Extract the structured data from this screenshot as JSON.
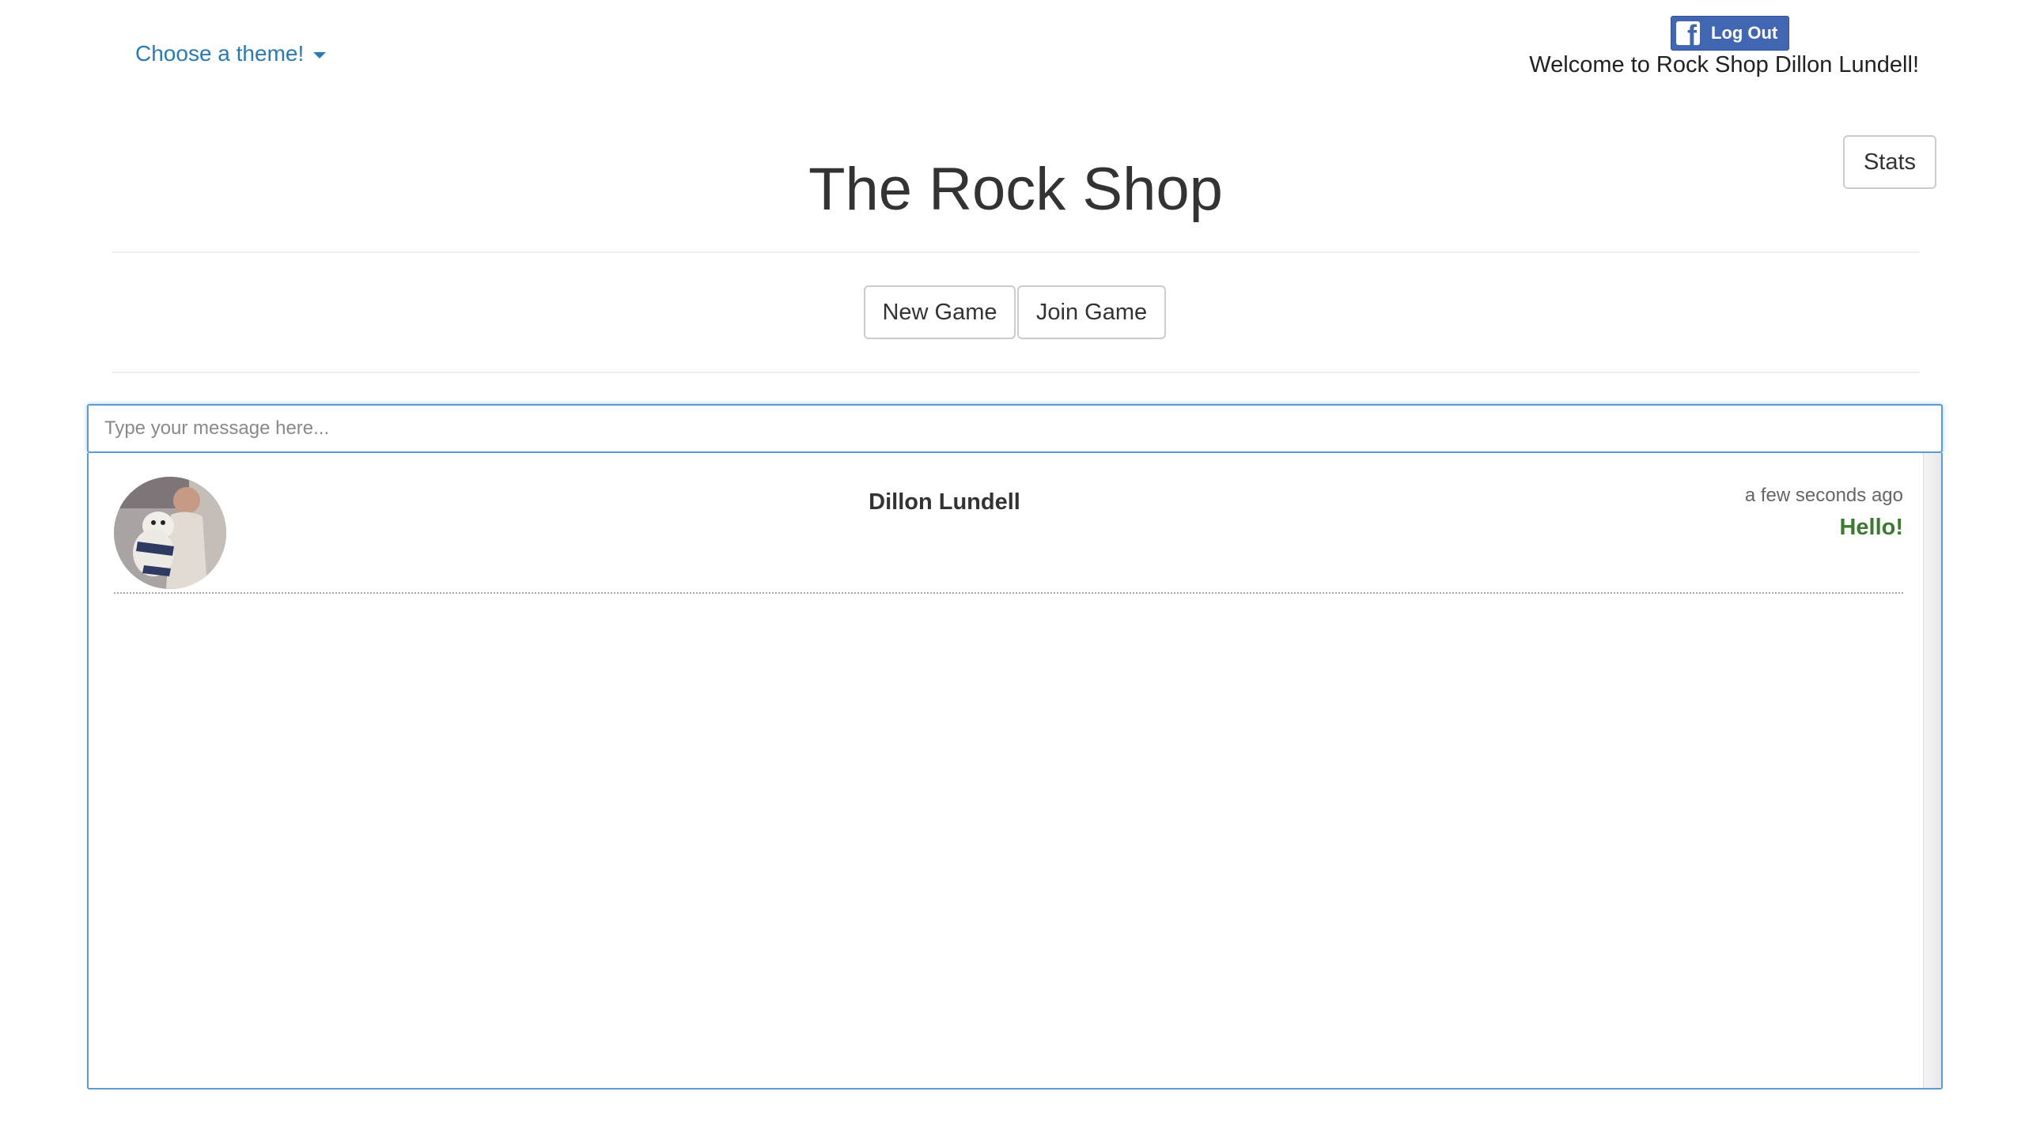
{
  "header": {
    "theme_dropdown_label": "Choose a theme!",
    "facebook_logout_label": "Log Out",
    "welcome_text": "Welcome to Rock Shop Dillon Lundell!",
    "stats_label": "Stats"
  },
  "main": {
    "title": "The Rock Shop",
    "new_game_label": "New Game",
    "join_game_label": "Join Game"
  },
  "chat": {
    "input_placeholder": "Type your message here...",
    "messages": [
      {
        "author": "Dillon Lundell",
        "time": "a few seconds ago",
        "text": "Hello!"
      }
    ]
  },
  "colors": {
    "link_blue": "#2a7ab8",
    "facebook_blue": "#4267b2",
    "focus_border": "#5b9bd5",
    "message_green": "#3c7a32"
  }
}
